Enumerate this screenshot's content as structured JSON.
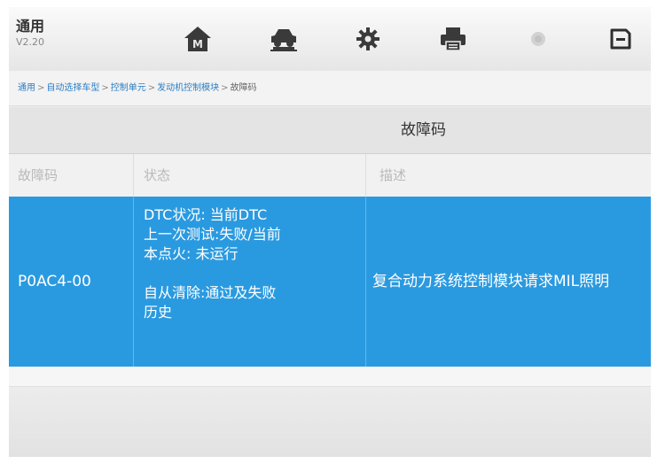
{
  "header": {
    "app_name": "通用",
    "version": "V2.20",
    "buttons": [
      {
        "name": "home",
        "icon": "home-icon"
      },
      {
        "name": "vehicle",
        "icon": "car-icon"
      },
      {
        "name": "settings",
        "icon": "gear-icon"
      },
      {
        "name": "print",
        "icon": "printer-icon"
      },
      {
        "name": "record",
        "icon": "record-icon"
      },
      {
        "name": "save",
        "icon": "save-icon"
      }
    ]
  },
  "breadcrumb": {
    "items": [
      "通用",
      "自动选择车型",
      "控制单元",
      "发动机控制模块"
    ],
    "current": "故障码",
    "separator": ">"
  },
  "section": {
    "title": "故障码"
  },
  "table": {
    "columns": [
      "故障码",
      "状态",
      "描述"
    ],
    "selected_row": {
      "code": "P0AC4-00",
      "status_lines": [
        "DTC状况: 当前DTC",
        "上一次测试:失败/当前",
        "本点火: 未运行"
      ],
      "status_lines_2": [
        "自从清除:通过及失败",
        "历史"
      ],
      "description": "复合动力系统控制模块请求MIL照明"
    }
  },
  "colors": {
    "selected_row": "#2a9ae0",
    "breadcrumb_link": "#2d7fc3",
    "header_text": "#b9b9b9"
  }
}
